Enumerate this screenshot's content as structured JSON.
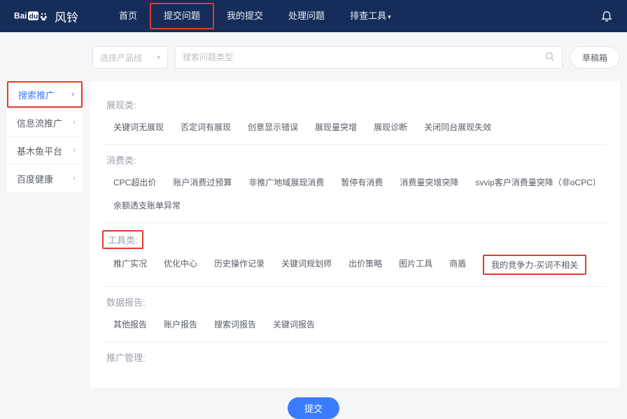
{
  "header": {
    "brand_logo": "Bai du",
    "brand_suffix": "风铃",
    "nav": [
      "首页",
      "提交问题",
      "我的提交",
      "处理问题",
      "排查工具"
    ],
    "bell_label": "notifications"
  },
  "filter": {
    "product_placeholder": "选择产品线",
    "search_placeholder": "搜索问题类型",
    "draft_btn": "草稿箱"
  },
  "sidebar": {
    "items": [
      {
        "label": "搜索推广",
        "active": true
      },
      {
        "label": "信息流推广",
        "active": false
      },
      {
        "label": "基木鱼平台",
        "active": false
      },
      {
        "label": "百度健康",
        "active": false
      }
    ]
  },
  "categories": [
    {
      "title": "展现类:",
      "title_red": false,
      "tags": [
        {
          "text": "关键词无展现"
        },
        {
          "text": "否定词有展现"
        },
        {
          "text": "创意显示错误"
        },
        {
          "text": "展现量突增"
        },
        {
          "text": "展现诊断"
        },
        {
          "text": "关闭同台展现失效"
        }
      ]
    },
    {
      "title": "消费类:",
      "title_red": false,
      "tags": [
        {
          "text": "CPC超出价"
        },
        {
          "text": "账户消费过预算"
        },
        {
          "text": "非推广地域展现消费"
        },
        {
          "text": "暂停有消费"
        },
        {
          "text": "消费量突增突降"
        },
        {
          "text": "svvip客户消费量突降（非oCPC）"
        },
        {
          "text": "余额透支账单异常"
        }
      ]
    },
    {
      "title": "工具类:",
      "title_red": true,
      "tags": [
        {
          "text": "推广实况"
        },
        {
          "text": "优化中心"
        },
        {
          "text": "历史操作记录"
        },
        {
          "text": "关键词规划师"
        },
        {
          "text": "出价策略"
        },
        {
          "text": "图片工具"
        },
        {
          "text": "商盾"
        },
        {
          "text": "我的竞争力-买词不相关",
          "red": true
        }
      ]
    },
    {
      "title": "数据报告:",
      "title_red": false,
      "tags": [
        {
          "text": "其他报告"
        },
        {
          "text": "账户报告"
        },
        {
          "text": "搜索词报告"
        },
        {
          "text": "关键词报告"
        }
      ]
    },
    {
      "title": "推广管理:",
      "title_red": false,
      "tags": []
    }
  ],
  "submit_label": "提交"
}
